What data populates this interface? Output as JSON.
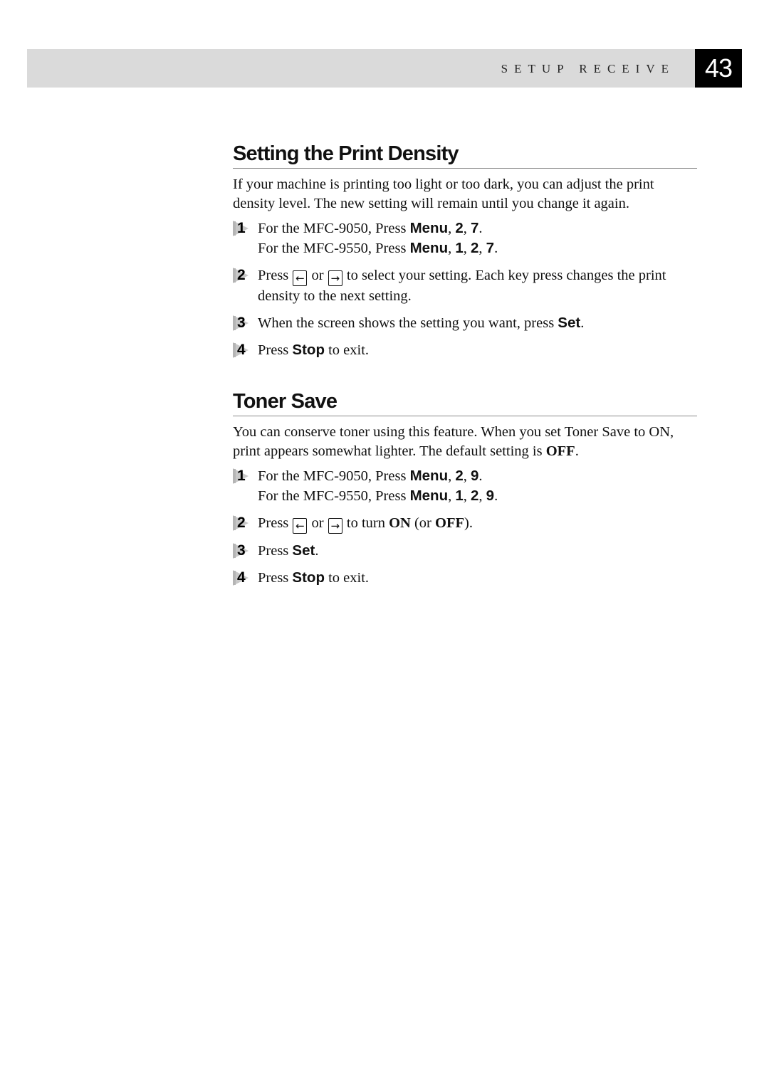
{
  "header": {
    "section_label": "SETUP RECEIVE",
    "page_number": "43"
  },
  "print_density": {
    "title": "Setting the Print Density",
    "intro": "If your machine is printing too light or too dark, you can adjust the print density level. The new setting will remain until you change it again.",
    "steps": [
      {
        "number": "1",
        "line1": {
          "prefix": "For the MFC-9050, Press ",
          "key": "Menu",
          "sep1": ", ",
          "k1": "2",
          "sep2": ", ",
          "k2": "7",
          "end": "."
        },
        "line2": {
          "prefix": "For the MFC-9550, Press ",
          "key": "Menu",
          "sep1": ", ",
          "k1": "1",
          "sep2": ", ",
          "k2": "2",
          "sep3": ", ",
          "k3": "7",
          "end": "."
        }
      },
      {
        "number": "2",
        "prefix": "Press ",
        "left_key_icon": "←",
        "or": " or ",
        "right_key_icon": "→",
        "suffix": " to select your setting. Each key press changes the print density to the next setting."
      },
      {
        "number": "3",
        "prefix": "When the screen shows the setting you want, press ",
        "key": "Set",
        "end": "."
      },
      {
        "number": "4",
        "prefix": "Press ",
        "key": "Stop",
        "suffix": " to exit."
      }
    ]
  },
  "toner_save": {
    "title": "Toner Save",
    "intro_prefix": "You can conserve toner using this feature. When you set Toner Save to ON, print appears somewhat lighter. The default setting is ",
    "intro_bold": "OFF",
    "intro_end": ".",
    "steps": [
      {
        "number": "1",
        "line1": {
          "prefix": "For the MFC-9050, Press ",
          "key": "Menu",
          "sep1": ", ",
          "k1": "2",
          "sep2": ", ",
          "k2": "9",
          "end": "."
        },
        "line2": {
          "prefix": "For the MFC-9550, Press ",
          "key": "Menu",
          "sep1": ", ",
          "k1": "1",
          "sep2": ", ",
          "k2": "2",
          "sep3": ", ",
          "k3": "9",
          "end": "."
        }
      },
      {
        "number": "2",
        "prefix": "Press ",
        "left_key_icon": "←",
        "or": " or ",
        "right_key_icon": "→",
        "mid": " to turn ",
        "on": "ON",
        "paren_open": " (or ",
        "off": "OFF",
        "paren_close": ")."
      },
      {
        "number": "3",
        "prefix": "Press ",
        "key": "Set",
        "end": "."
      },
      {
        "number": "4",
        "prefix": "Press ",
        "key": "Stop",
        "suffix": " to exit."
      }
    ]
  }
}
